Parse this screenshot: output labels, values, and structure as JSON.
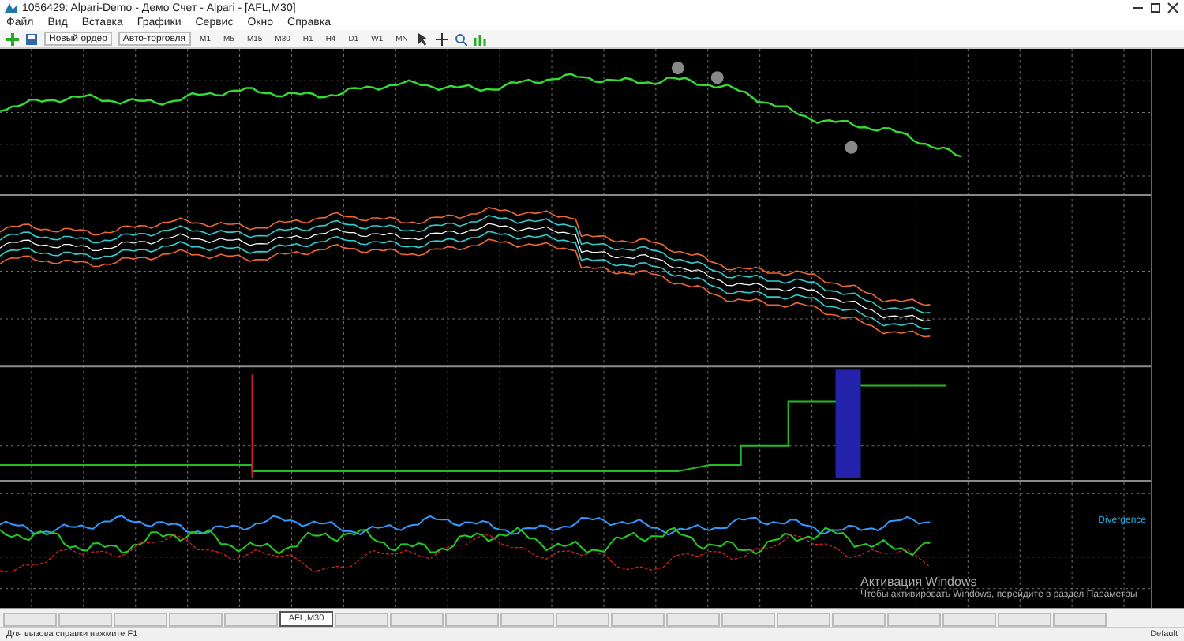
{
  "window": {
    "title": "1056429: Alpari-Demo - Демо Счет - Alpari - [AFL,M30]"
  },
  "menu": [
    "Файл",
    "Вид",
    "Вставка",
    "Графики",
    "Сервис",
    "Окно",
    "Справка"
  ],
  "toolbar": {
    "buttons": [
      {
        "label": "Новый ордер"
      },
      {
        "label": "Авто-торговля"
      }
    ],
    "timeframes": [
      "M1",
      "M5",
      "M15",
      "M30",
      "H1",
      "H4",
      "D1",
      "W1",
      "MN"
    ]
  },
  "indicator_label": "Divergence",
  "chart_tabs": [
    {
      "selected": false
    },
    {
      "selected": false
    },
    {
      "selected": false
    },
    {
      "selected": false
    },
    {
      "selected": false
    },
    {
      "label": "AFL,M30",
      "selected": true
    },
    {
      "selected": false
    },
    {
      "selected": false
    },
    {
      "selected": false
    },
    {
      "selected": false
    },
    {
      "selected": false
    },
    {
      "selected": false
    },
    {
      "selected": false
    },
    {
      "selected": false
    },
    {
      "selected": false
    },
    {
      "selected": false
    },
    {
      "selected": false
    },
    {
      "selected": false
    },
    {
      "selected": false
    },
    {
      "selected": false
    }
  ],
  "status_bar": {
    "help": "Для вызова справки нажмите F1",
    "profile": "Default"
  },
  "activation_notice": {
    "title": "Активация Windows",
    "text": "Чтобы активировать Windows, перейдите в раздел Параметры"
  }
}
